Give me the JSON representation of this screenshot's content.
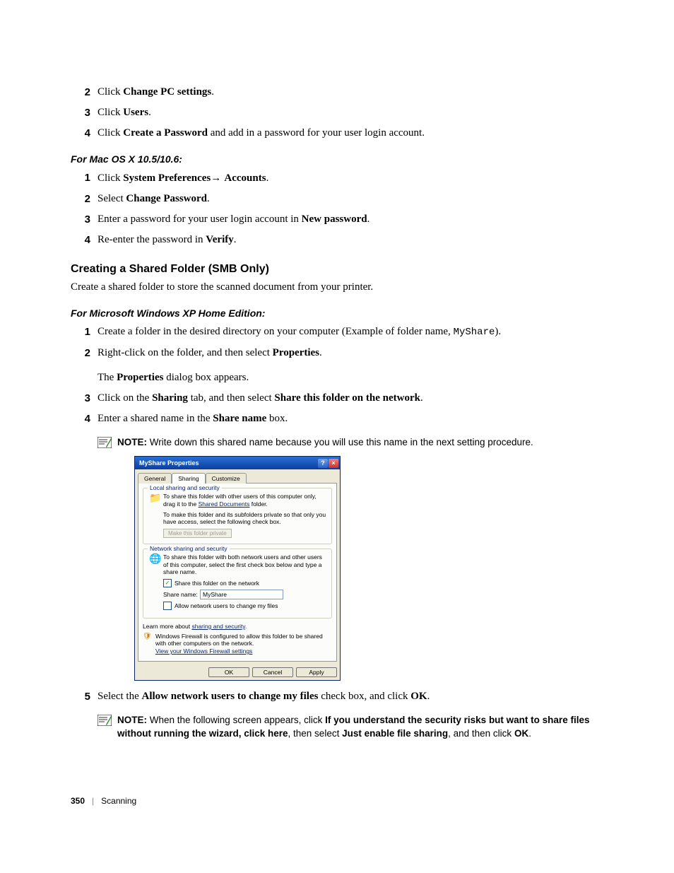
{
  "steps_top": [
    {
      "num": "2",
      "pre": "Click ",
      "bold": "Change PC settings",
      "post": "."
    },
    {
      "num": "3",
      "pre": "Click ",
      "bold": "Users",
      "post": "."
    },
    {
      "num": "4",
      "pre": "Click ",
      "bold": "Create a Password",
      "post": " and add in a password for your user login account."
    }
  ],
  "mac_heading": "For Mac OS X 10.5/10.6:",
  "mac_steps": [
    {
      "num": "1",
      "pre": "Click ",
      "bold": "System Preferences",
      "arrow": "→ ",
      "bold2": "Accounts",
      "post": "."
    },
    {
      "num": "2",
      "pre": "Select ",
      "bold": "Change Password",
      "post": "."
    },
    {
      "num": "3",
      "pre": "Enter a password for your user login account in ",
      "bold": "New password",
      "post": "."
    },
    {
      "num": "4",
      "pre": "Re-enter the password in ",
      "bold": "Verify",
      "post": "."
    }
  ],
  "smb_heading": "Creating a Shared Folder (SMB Only)",
  "smb_intro": "Create a shared folder to store the scanned document from your printer.",
  "xp_heading": "For Microsoft Windows XP Home Edition:",
  "xp_steps_a": [
    {
      "num": "1",
      "pre": "Create a folder in the desired directory on your computer (Example of folder name, ",
      "mono": "MyShare",
      "post": ")."
    },
    {
      "num": "2",
      "pre": "Right-click on the folder, and then select ",
      "bold": "Properties",
      "post": "."
    }
  ],
  "xp_sub": "The ",
  "xp_sub_bold": "Properties",
  "xp_sub_post": " dialog box appears.",
  "xp_steps_b": [
    {
      "num": "3",
      "pre": "Click on the ",
      "bold": "Sharing",
      "mid": " tab, and then select ",
      "bold2": "Share this folder on the network",
      "post": "."
    },
    {
      "num": "4",
      "pre": "Enter a shared name in the ",
      "bold": "Share name",
      "post": " box."
    }
  ],
  "note1": {
    "label": "NOTE: ",
    "text": "Write down this shared name because you will use this name in the next setting procedure."
  },
  "dialog": {
    "title": "MyShare Properties",
    "tabs": [
      "General",
      "Sharing",
      "Customize"
    ],
    "group1_title": "Local sharing and security",
    "g1_text1_a": "To share this folder with other users of this computer only, drag it to the ",
    "g1_link": "Shared Documents",
    "g1_text1_b": " folder.",
    "g1_text2": "To make this folder and its subfolders private so that only you have access, select the following check box.",
    "g1_btn": "Make this folder private",
    "group2_title": "Network sharing and security",
    "g2_text": "To share this folder with both network users and other users of this computer, select the first check box below and type a share name.",
    "g2_check1": "Share this folder on the network",
    "g2_share_label": "Share name:",
    "g2_share_value": "MyShare",
    "g2_check2": "Allow network users to change my files",
    "learn": "Learn more about ",
    "learn_link": "sharing and security",
    "fw_text": "Windows Firewall is configured to allow this folder to be shared with other computers on the network.",
    "fw_link": "View your Windows Firewall settings",
    "buttons": [
      "OK",
      "Cancel",
      "Apply"
    ]
  },
  "step5": {
    "num": "5",
    "pre": "Select the ",
    "bold": "Allow network users to change my files",
    "mid": " check box, and click ",
    "bold2": "OK",
    "post": "."
  },
  "note2": {
    "label": "NOTE: ",
    "pre": "When the following screen appears, click ",
    "bold1": "If you understand the security risks but want to share files without running the wizard, click here",
    "mid": ", then select ",
    "bold2": "Just enable file sharing",
    "mid2": ", and then click ",
    "bold3": "OK",
    "post": "."
  },
  "footer": {
    "page": "350",
    "section": "Scanning"
  }
}
